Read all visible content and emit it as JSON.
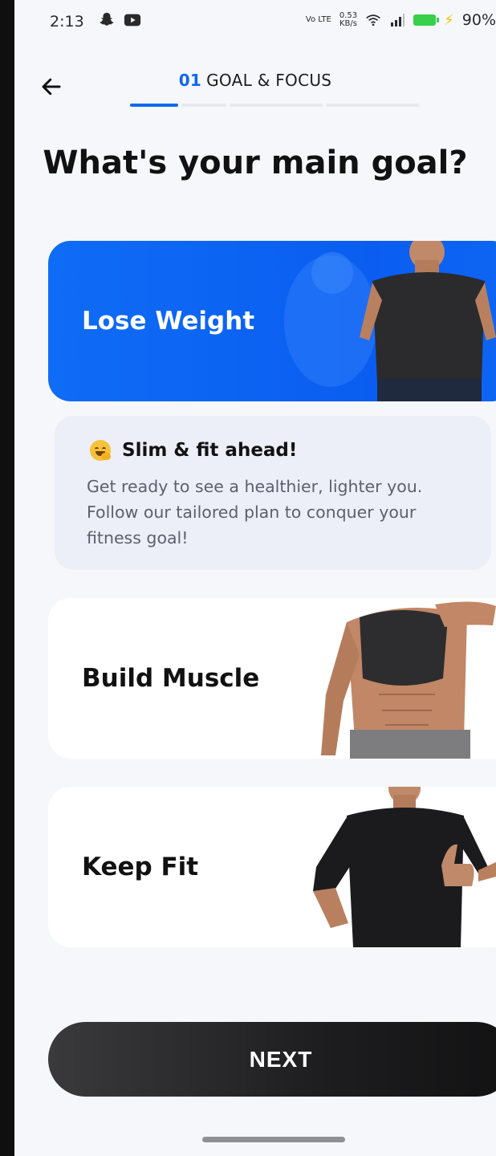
{
  "status_bar": {
    "time": "2:13",
    "network_speed_value": "0.53",
    "network_speed_unit": "KB/s",
    "network_type": "Vo LTE",
    "battery": "90%"
  },
  "header": {
    "step_number": "01",
    "step_title": "GOAL & FOCUS",
    "progress_fraction": 0.25
  },
  "page": {
    "question": "What's your main goal?"
  },
  "options": [
    {
      "label": "Lose Weight",
      "selected": true
    },
    {
      "label": "Build Muscle",
      "selected": false
    },
    {
      "label": "Keep Fit",
      "selected": false
    }
  ],
  "info": {
    "title": "Slim & fit ahead!",
    "text": "Get ready to see a healthier, lighter you. Follow our tailored plan to conquer your fitness goal!"
  },
  "footer": {
    "next_label": "NEXT"
  },
  "colors": {
    "accent": "#0f67f1",
    "background": "#f6f7fb",
    "button": "#1d1d1f"
  },
  "icons": {
    "back": "back-arrow-icon",
    "snapchat": "snapchat-icon",
    "youtube": "youtube-icon",
    "wifi": "wifi-icon",
    "signal": "signal-icon",
    "battery": "battery-icon",
    "emoji": "smiling-hug-emoji-icon"
  }
}
